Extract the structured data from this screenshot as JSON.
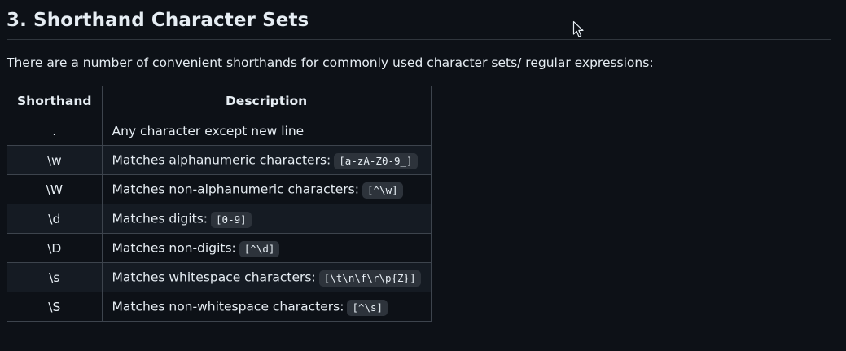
{
  "section": {
    "heading": "3. Shorthand Character Sets",
    "intro": "There are a number of convenient shorthands for commonly used character sets/ regular expressions:"
  },
  "table": {
    "headers": {
      "shorthand": "Shorthand",
      "description": "Description"
    },
    "rows": [
      {
        "shorthand": ".",
        "description": "Any character except new line",
        "code": ""
      },
      {
        "shorthand": "\\w",
        "description": "Matches alphanumeric characters:",
        "code": "[a-zA-Z0-9_]"
      },
      {
        "shorthand": "\\W",
        "description": "Matches non-alphanumeric characters:",
        "code": "[^\\w]"
      },
      {
        "shorthand": "\\d",
        "description": "Matches digits:",
        "code": "[0-9]"
      },
      {
        "shorthand": "\\D",
        "description": "Matches non-digits:",
        "code": "[^\\d]"
      },
      {
        "shorthand": "\\s",
        "description": "Matches whitespace characters:",
        "code": "[\\t\\n\\f\\r\\p{Z}]"
      },
      {
        "shorthand": "\\S",
        "description": "Matches non-whitespace characters:",
        "code": "[^\\s]"
      }
    ]
  },
  "icons": {
    "cursor": "mouse-pointer-icon"
  },
  "colors": {
    "background": "#0d1117",
    "text": "#e6edf3",
    "border": "#3d444d",
    "row_alt": "#151b23",
    "code_bg": "#2d333b"
  }
}
